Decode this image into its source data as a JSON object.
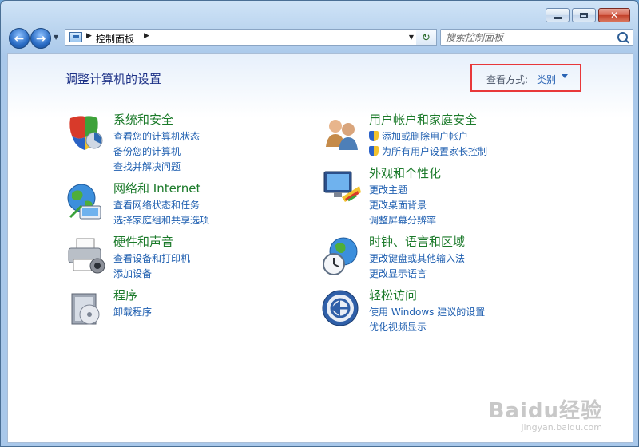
{
  "window": {
    "controls": [
      "minimize",
      "maximize",
      "close"
    ]
  },
  "navbar": {
    "breadcrumb": "控制面板",
    "search_placeholder": "搜索控制面板"
  },
  "main": {
    "page_title": "调整计算机的设置",
    "view_by_label": "查看方式:",
    "view_by_value": "类别",
    "categories": [
      {
        "title": "系统和安全",
        "icon": "shield-security-icon",
        "links": [
          "查看您的计算机状态",
          "备份您的计算机",
          "查找并解决问题"
        ]
      },
      {
        "title": "网络和 Internet",
        "icon": "globe-network-icon",
        "links": [
          "查看网络状态和任务",
          "选择家庭组和共享选项"
        ]
      },
      {
        "title": "硬件和声音",
        "icon": "printer-hardware-icon",
        "links": [
          "查看设备和打印机",
          "添加设备"
        ]
      },
      {
        "title": "程序",
        "icon": "programs-box-icon",
        "links": [
          "卸载程序"
        ]
      },
      {
        "title": "用户帐户和家庭安全",
        "icon": "users-icon",
        "links": [
          "添加或删除用户帐户",
          "为所有用户设置家长控制"
        ]
      },
      {
        "title": "外观和个性化",
        "icon": "monitor-palette-icon",
        "links": [
          "更改主题",
          "更改桌面背景",
          "调整屏幕分辨率"
        ]
      },
      {
        "title": "时钟、语言和区域",
        "icon": "globe-clock-icon",
        "links": [
          "更改键盘或其他输入法",
          "更改显示语言"
        ]
      },
      {
        "title": "轻松访问",
        "icon": "ease-of-access-icon",
        "links": [
          "使用 Windows 建议的设置",
          "优化视频显示"
        ]
      }
    ]
  },
  "watermark": {
    "line1": "Baidu经验",
    "line2": "jingyan.baidu.com"
  },
  "colors": {
    "title_green": "#1b7a2a",
    "link_blue": "#1f5fb0",
    "heading_blue": "#1e3287",
    "highlight_red": "#e8383a"
  }
}
